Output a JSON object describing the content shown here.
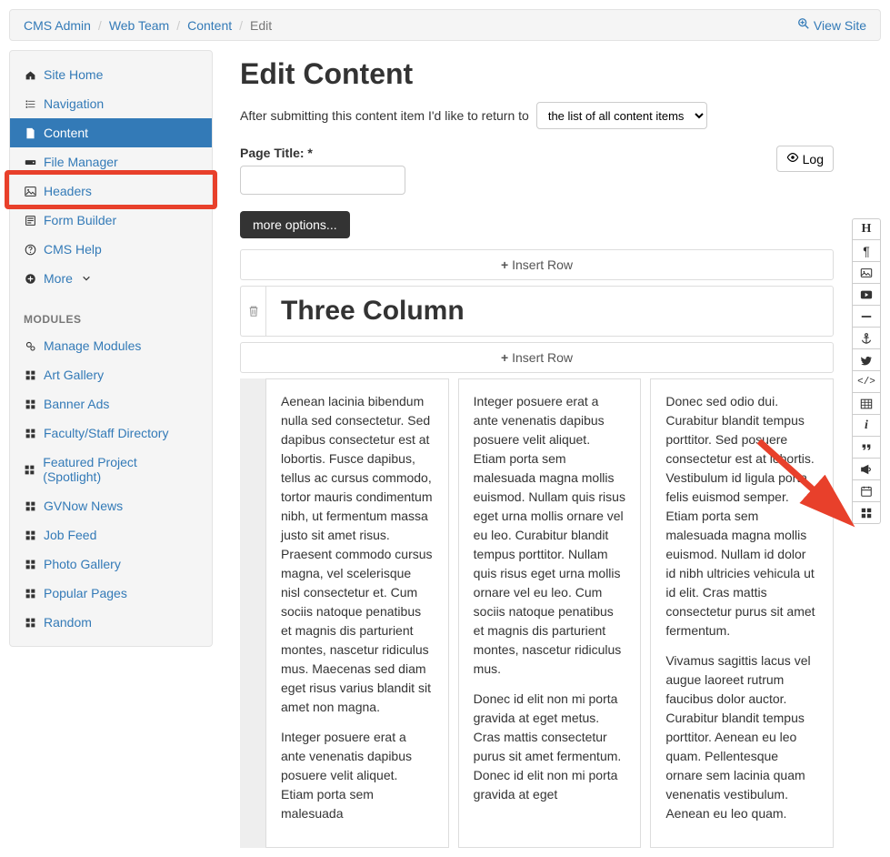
{
  "breadcrumb": {
    "items": [
      "CMS Admin",
      "Web Team",
      "Content"
    ],
    "current": "Edit",
    "view_site": "View Site"
  },
  "sidebar": {
    "primary": [
      {
        "icon": "home",
        "label": "Site Home"
      },
      {
        "icon": "list",
        "label": "Navigation"
      },
      {
        "icon": "file",
        "label": "Content",
        "active": true
      },
      {
        "icon": "hdd",
        "label": "File Manager"
      },
      {
        "icon": "image",
        "label": "Headers"
      },
      {
        "icon": "form",
        "label": "Form Builder"
      },
      {
        "icon": "help",
        "label": "CMS Help"
      },
      {
        "icon": "plus",
        "label": "More",
        "chevron": true
      }
    ],
    "modules_header": "MODULES",
    "modules": [
      {
        "icon": "cogs",
        "label": "Manage Modules"
      },
      {
        "icon": "grid",
        "label": "Art Gallery",
        "search": true
      },
      {
        "icon": "grid",
        "label": "Banner Ads",
        "search": true
      },
      {
        "icon": "grid",
        "label": "Faculty/Staff Directory",
        "search": true
      },
      {
        "icon": "grid",
        "label": "Featured Project (Spotlight)",
        "search": true
      },
      {
        "icon": "grid",
        "label": "GVNow News",
        "search": true
      },
      {
        "icon": "grid",
        "label": "Job Feed",
        "search": true
      },
      {
        "icon": "grid",
        "label": "Photo Gallery",
        "search": true
      },
      {
        "icon": "grid",
        "label": "Popular Pages",
        "search": true
      },
      {
        "icon": "grid",
        "label": "Random",
        "search": true
      }
    ]
  },
  "main": {
    "heading": "Edit Content",
    "return_text": "After submitting this content item I'd like to return to",
    "return_select": "the list of all content items",
    "page_title_label": "Page Title: *",
    "page_title_value": "",
    "log_btn": "Log",
    "more_options": "more options...",
    "insert_row": "Insert Row",
    "row_title": "Three Column",
    "cols": [
      "Aenean lacinia bibendum nulla sed consectetur. Sed dapibus consectetur est at lobortis. Fusce dapibus, tellus ac cursus commodo, tortor mauris condimentum nibh, ut fermentum massa justo sit amet risus. Praesent commodo cursus magna, vel scelerisque nisl consectetur et. Cum sociis natoque penatibus et magnis dis parturient montes, nascetur ridiculus mus. Maecenas sed diam eget risus varius blandit sit amet non magna.\n\nInteger posuere erat a ante venenatis dapibus posuere velit aliquet. Etiam porta sem malesuada",
      "Integer posuere erat a ante venenatis dapibus posuere velit aliquet. Etiam porta sem malesuada magna mollis euismod. Nullam quis risus eget urna mollis ornare vel eu leo. Curabitur blandit tempus porttitor. Nullam quis risus eget urna mollis ornare vel eu leo. Cum sociis natoque penatibus et magnis dis parturient montes, nascetur ridiculus mus.\n\nDonec id elit non mi porta gravida at eget metus. Cras mattis consectetur purus sit amet fermentum. Donec id elit non mi porta gravida at eget",
      "Donec sed odio dui. Curabitur blandit tempus porttitor. Sed posuere consectetur est at lobortis. Vestibulum id ligula porta felis euismod semper. Etiam porta sem malesuada magna mollis euismod. Nullam id dolor id nibh ultricies vehicula ut id elit. Cras mattis consectetur purus sit amet fermentum.\n\nVivamus sagittis lacus vel augue laoreet rutrum faucibus dolor auctor. Curabitur blandit tempus porttitor. Aenean eu leo quam. Pellentesque ornare sem lacinia quam venenatis vestibulum. Aenean eu leo quam."
    ]
  },
  "toolbar": {
    "items": [
      {
        "name": "heading",
        "glyph": "H"
      },
      {
        "name": "paragraph",
        "glyph": "¶"
      },
      {
        "name": "image",
        "glyph": "img"
      },
      {
        "name": "video",
        "glyph": "vid"
      },
      {
        "name": "divider",
        "glyph": "—"
      },
      {
        "name": "anchor",
        "glyph": "anchor"
      },
      {
        "name": "twitter",
        "glyph": "tw"
      },
      {
        "name": "code",
        "glyph": "</>"
      },
      {
        "name": "table",
        "glyph": "tbl"
      },
      {
        "name": "info",
        "glyph": "i"
      },
      {
        "name": "quote",
        "glyph": "quote"
      },
      {
        "name": "announce",
        "glyph": "ann"
      },
      {
        "name": "calendar",
        "glyph": "cal"
      },
      {
        "name": "grid",
        "glyph": "grid"
      }
    ]
  }
}
